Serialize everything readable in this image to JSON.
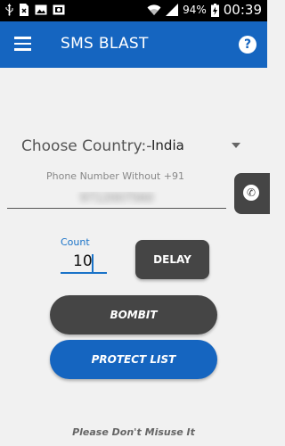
{
  "status_bar": {
    "battery": "94%",
    "time": "00:39",
    "icons": [
      "usb-icon",
      "sim-card-icon",
      "image-icon",
      "picture-frame-icon",
      "wifi-icon",
      "signal-icon",
      "battery-charging-icon"
    ]
  },
  "app_bar": {
    "title": "SMS BLAST",
    "menu_icon": "hamburger-menu-icon",
    "help_glyph": "?",
    "bg_color": "#1565c0"
  },
  "form": {
    "country_label": "Choose Country:-",
    "country_value": "India",
    "phone_label": "Phone Number Without +91",
    "phone_value": "9712007560",
    "count_label": "Count",
    "count_value": "10"
  },
  "buttons": {
    "delay": "DELAY",
    "bombit": "BOMBIT",
    "protect_list": "PROTECT LIST"
  },
  "side_tab_icon": "phone-icon",
  "footer": "Please Don't Misuse It"
}
